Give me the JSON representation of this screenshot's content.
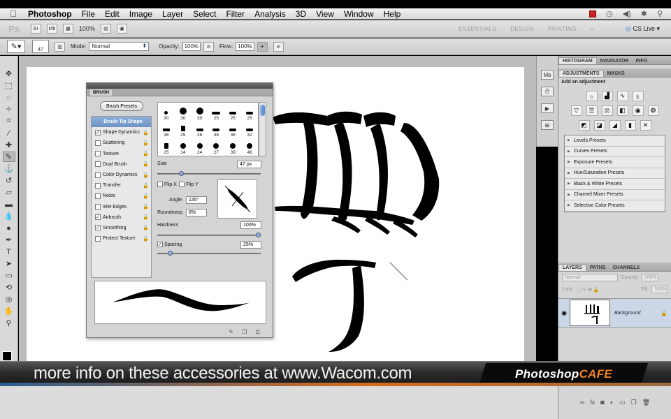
{
  "menubar": {
    "app": "Photoshop",
    "items": [
      "File",
      "Edit",
      "Image",
      "Layer",
      "Select",
      "Filter",
      "Analysis",
      "3D",
      "View",
      "Window",
      "Help"
    ]
  },
  "appbar": {
    "logo": "Ps",
    "zoom": "100%",
    "workspaces": [
      "ESSENTIALS",
      "DESIGN",
      "PAINTING"
    ],
    "cs_live": "CS Live"
  },
  "options": {
    "brush_size": "47",
    "mode_label": "Mode:",
    "mode_value": "Normal",
    "opacity_label": "Opacity:",
    "opacity_value": "100%",
    "flow_label": "Flow:",
    "flow_value": "100%"
  },
  "brush_panel": {
    "title": "BRUSH",
    "presets_button": "Brush Presets",
    "options": [
      {
        "label": "Brush Tip Shape",
        "selected": true
      },
      {
        "label": "Shape Dynamics",
        "checked": true
      },
      {
        "label": "Scattering",
        "checked": false
      },
      {
        "label": "Texture",
        "checked": false
      },
      {
        "label": "Dual Brush",
        "checked": false
      },
      {
        "label": "Color Dynamics",
        "checked": false
      },
      {
        "label": "Transfer",
        "checked": false
      },
      {
        "label": "Noise",
        "checked": false
      },
      {
        "label": "Wet Edges",
        "checked": false
      },
      {
        "label": "Airbrush",
        "checked": true
      },
      {
        "label": "Smoothing",
        "checked": true
      },
      {
        "label": "Protect Texture",
        "checked": false
      }
    ],
    "tip_sizes": [
      "30",
      "30",
      "30",
      "25",
      "25",
      "25",
      "36",
      "25",
      "36",
      "36",
      "36",
      "32",
      "25",
      "14",
      "24",
      "27",
      "39",
      "46"
    ],
    "size_label": "Size",
    "size_value": "47 px",
    "flip_x": "Flip X",
    "flip_y": "Flip Y",
    "angle_label": "Angle:",
    "angle_value": "135°",
    "roundness_label": "Roundness:",
    "roundness_value": "8%",
    "hardness_label": "Hardness",
    "hardness_value": "100%",
    "spacing_label": "Spacing",
    "spacing_value": "25%"
  },
  "right": {
    "tabs1": [
      "HISTOGRAM",
      "NAVIGATOR",
      "INFO"
    ],
    "tabs2": [
      "ADJUSTMENTS",
      "MASKS"
    ],
    "add_adjustment": "Add an adjustment",
    "presets": [
      "Levels Presets",
      "Curves Presets",
      "Exposure Presets",
      "Hue/Saturation Presets",
      "Black & White Presets",
      "Channel Mixer Presets",
      "Selective Color Presets"
    ],
    "tabs3": [
      "LAYERS",
      "PATHS",
      "CHANNELS"
    ],
    "blend_mode": "Normal",
    "opacity_label": "Opacity:",
    "opacity_value": "100%",
    "lock_label": "Lock:",
    "fill_label": "Fill:",
    "fill_value": "100%",
    "layer_name": "Background"
  },
  "banner": {
    "text": "more info on these accessories at www.Wacom.com",
    "logo_a": "Photoshop",
    "logo_b": "CAFE"
  }
}
